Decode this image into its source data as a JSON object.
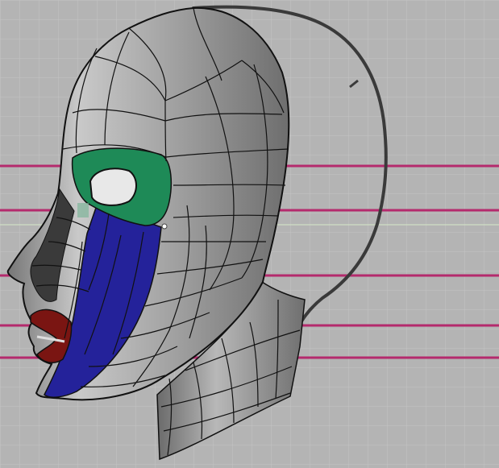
{
  "viewport": {
    "background": "#b4b4b4",
    "grid_color": "#c4c4c4",
    "guide_color": "#b52a6d",
    "mesh_fill": "#a6a6a6",
    "wire_color": "#111111",
    "eye_ring_color": "#1e8a57",
    "cheek_color": "#24229a",
    "lips_color": "#7a1512",
    "outline_color": "#3a3a3a"
  }
}
